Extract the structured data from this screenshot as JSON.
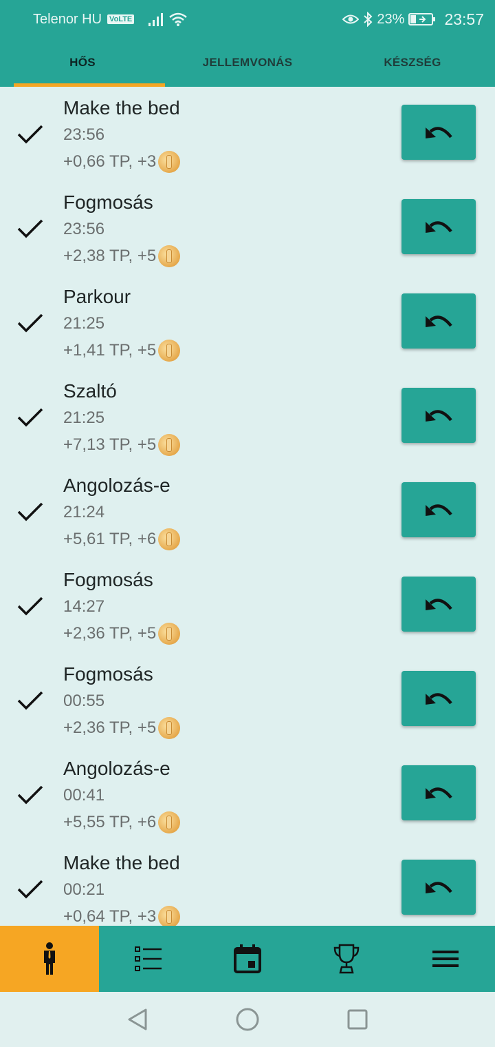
{
  "status_bar": {
    "carrier": "Telenor HU",
    "network_badge": "VoLTE",
    "battery_percent": "23%",
    "time": "23:57"
  },
  "tabs": [
    {
      "label": "HŐS",
      "active": true
    },
    {
      "label": "JELLEMVONÁS",
      "active": false
    },
    {
      "label": "KÉSZSÉG",
      "active": false
    }
  ],
  "entries": [
    {
      "title": "Make the bed",
      "time": "23:56",
      "reward": "+0,66 TP, +3"
    },
    {
      "title": "Fogmosás",
      "time": "23:56",
      "reward": "+2,38 TP, +5"
    },
    {
      "title": "Parkour",
      "time": "21:25",
      "reward": "+1,41 TP, +5"
    },
    {
      "title": "Szaltó",
      "time": "21:25",
      "reward": "+7,13 TP, +5"
    },
    {
      "title": "Angolozás-e",
      "time": "21:24",
      "reward": "+5,61 TP, +6"
    },
    {
      "title": "Fogmosás",
      "time": "14:27",
      "reward": "+2,36 TP, +5"
    },
    {
      "title": "Fogmosás",
      "time": "00:55",
      "reward": "+2,36 TP, +5"
    },
    {
      "title": "Angolozás-e",
      "time": "00:41",
      "reward": "+5,55 TP, +6"
    },
    {
      "title": "Make the bed",
      "time": "00:21",
      "reward": "+0,64 TP, +3"
    }
  ],
  "bottom_nav": [
    {
      "icon": "hero-icon",
      "active": true
    },
    {
      "icon": "checklist-icon",
      "active": false
    },
    {
      "icon": "calendar-icon",
      "active": false
    },
    {
      "icon": "trophy-icon",
      "active": false
    },
    {
      "icon": "menu-icon",
      "active": false
    }
  ],
  "colors": {
    "primary": "#26a596",
    "accent": "#f6a623",
    "background": "#dff0ef"
  }
}
